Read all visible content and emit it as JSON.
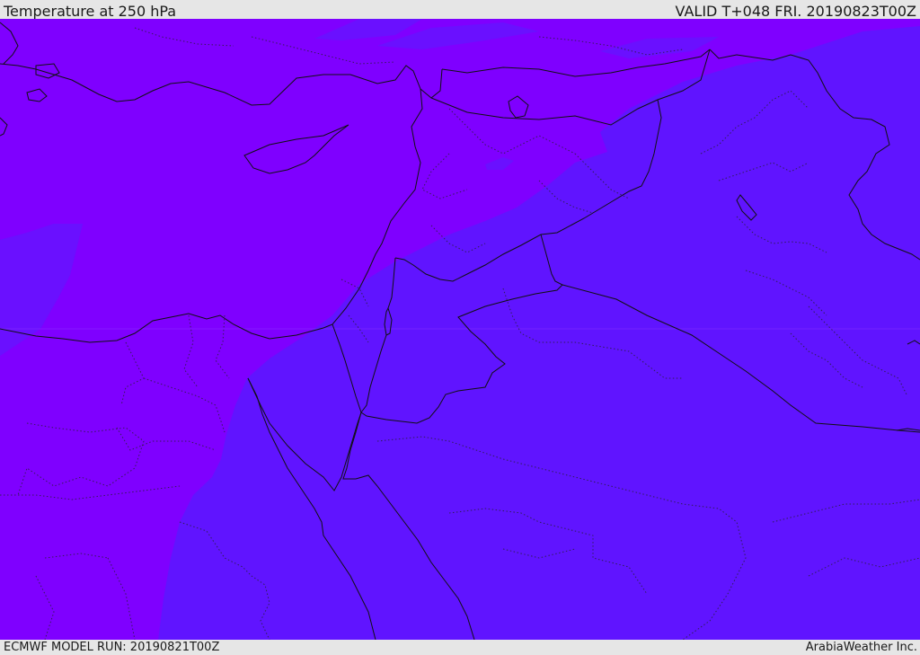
{
  "header": {
    "title": "Temperature at 250 hPa",
    "valid": "VALID T+048 FRI. 20190823T00Z"
  },
  "footer": {
    "model_run": "ECMWF MODEL RUN: 20190821T00Z",
    "credit": "ArabiaWeather Inc."
  },
  "colors": {
    "band_warm": "#7f00ff",
    "band_cool": "#6014ff",
    "frame": "#e6e6e6",
    "boundaries": "#111111"
  }
}
